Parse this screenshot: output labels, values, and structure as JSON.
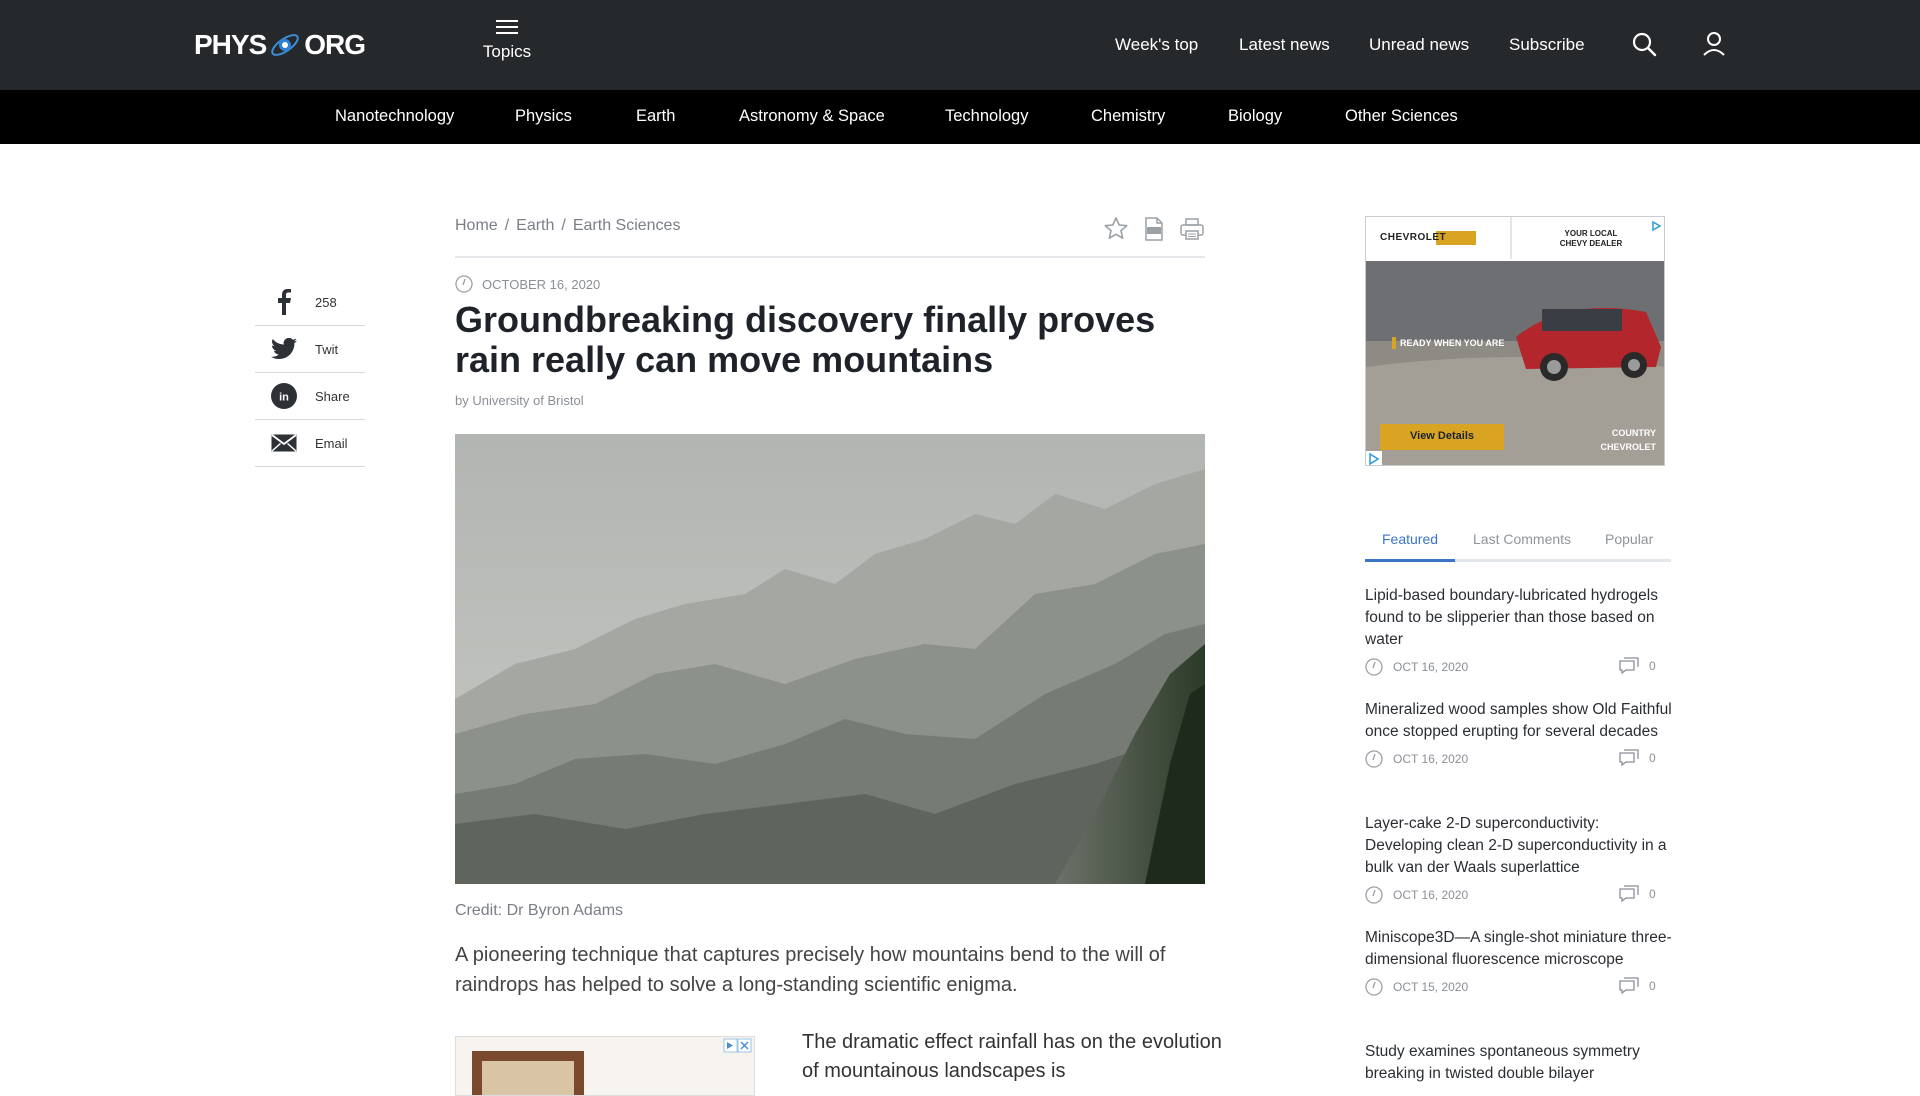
{
  "header": {
    "logo_left": "PHYS",
    "logo_right": "ORG",
    "topics_label": "Topics",
    "nav": [
      "Week's top",
      "Latest news",
      "Unread news",
      "Subscribe"
    ]
  },
  "categories": [
    "Nanotechnology",
    "Physics",
    "Earth",
    "Astronomy & Space",
    "Technology",
    "Chemistry",
    "Biology",
    "Other Sciences"
  ],
  "share": [
    {
      "icon": "facebook-icon",
      "label": "258"
    },
    {
      "icon": "twitter-icon",
      "label": "Twit"
    },
    {
      "icon": "linkedin-icon",
      "label": "Share"
    },
    {
      "icon": "email-icon",
      "label": "Email"
    }
  ],
  "breadcrumb": [
    "Home",
    "Earth",
    "Earth Sciences"
  ],
  "article": {
    "date": "OCTOBER 16, 2020",
    "title": "Groundbreaking discovery finally proves rain really can move mountains",
    "byline": "by University of Bristol",
    "credit": "Credit: Dr Byron Adams",
    "lead": "A pioneering technique that captures precisely how mountains bend to the will of raindrops has helped to solve a long-standing scientific enigma.",
    "para": "The dramatic effect rainfall has on the evolution of mountainous landscapes is"
  },
  "ad": {
    "brand": "CHEVROLET",
    "dealer_line1": "YOUR LOCAL",
    "dealer_line2": "CHEVY DEALER",
    "tagline": "READY WHEN YOU ARE",
    "cta": "View Details",
    "footer_line1": "COUNTRY",
    "footer_line2": "CHEVROLET"
  },
  "tabs": [
    "Featured",
    "Last Comments",
    "Popular"
  ],
  "news": [
    {
      "title": "Lipid-based boundary-lubricated hydrogels found to be slipperier than those based on water",
      "date": "OCT 16, 2020",
      "comments": "0"
    },
    {
      "title": "Mineralized wood samples show Old Faithful once stopped erupting for several decades",
      "date": "OCT 16, 2020",
      "comments": "0"
    },
    {
      "title": "Layer-cake 2-D superconductivity: Developing clean 2-D superconductivity in a bulk van der Waals superlattice",
      "date": "OCT 16, 2020",
      "comments": "0"
    },
    {
      "title": "Miniscope3D—A single-shot miniature three-dimensional fluorescence microscope",
      "date": "OCT 15, 2020",
      "comments": "0"
    },
    {
      "title": "Study examines spontaneous symmetry breaking in twisted double bilayer",
      "date": "",
      "comments": ""
    }
  ],
  "colors": {
    "header_bg": "#26292c",
    "catbar_bg": "#000000",
    "accent": "#3a76c4"
  }
}
